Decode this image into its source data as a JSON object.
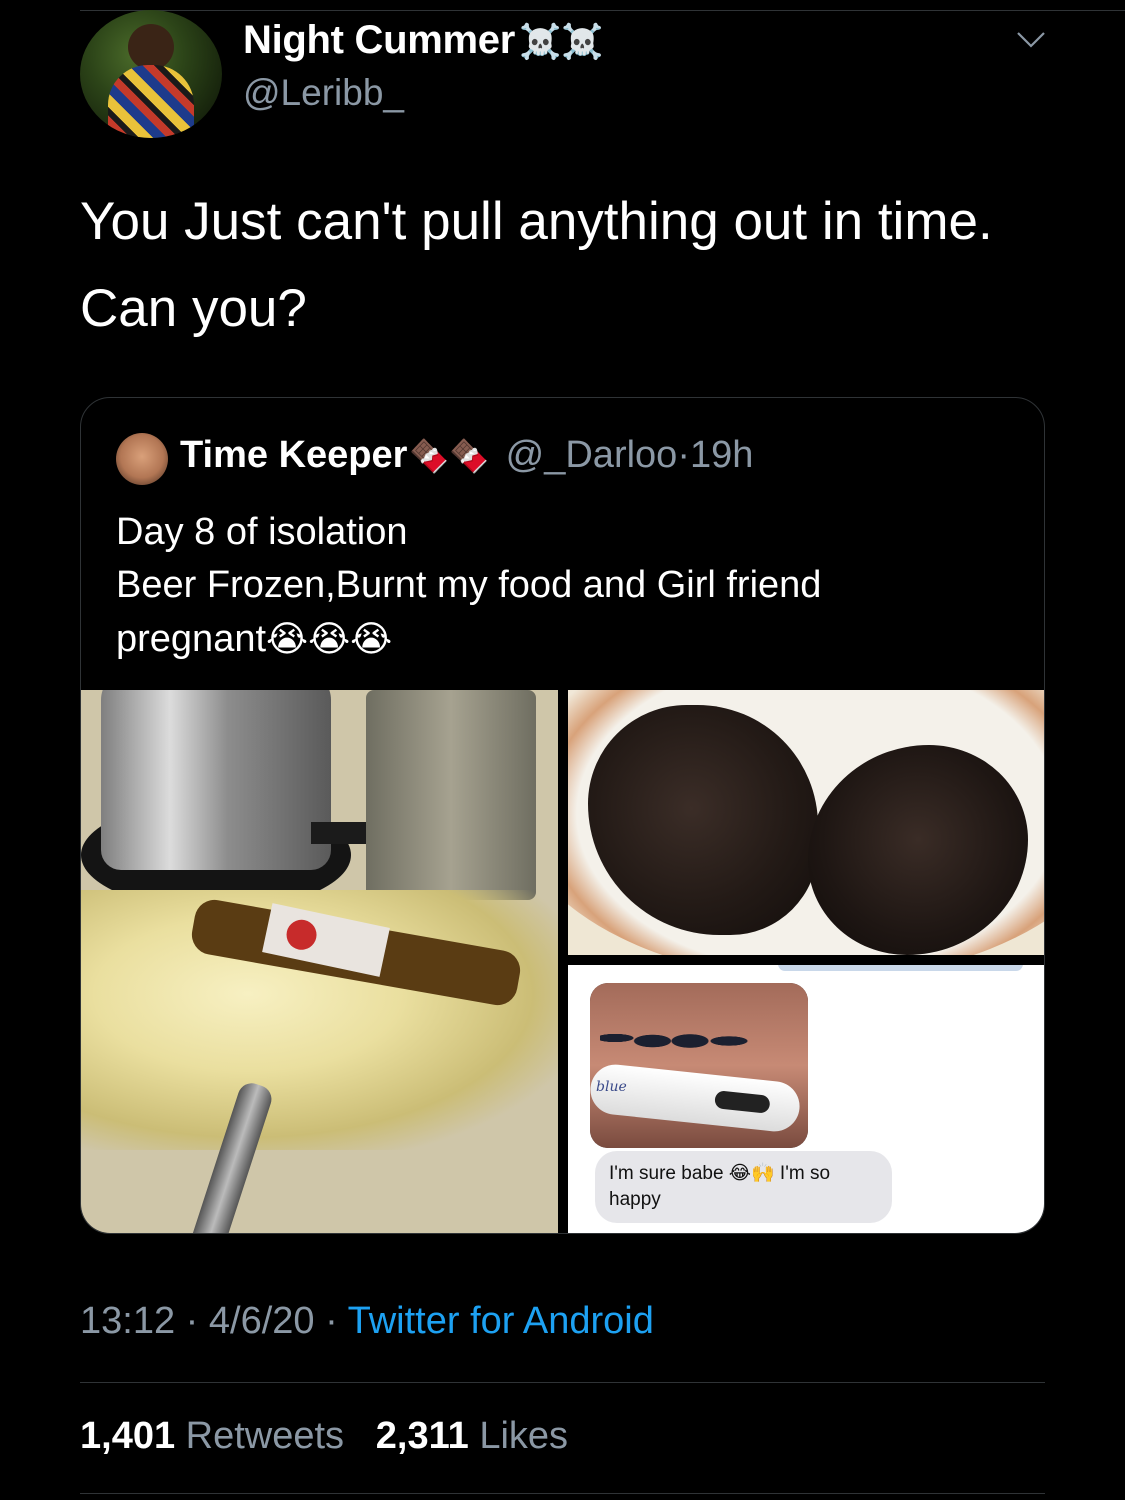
{
  "author": {
    "display_name": "Night Cummer",
    "name_emojis": "☠️☠️",
    "handle": "@Leribb_"
  },
  "tweet": {
    "text": "You Just can't pull anything out in time.\nCan you?"
  },
  "quoted_tweet": {
    "display_name": "Time Keeper",
    "name_emojis": "🍫🍫",
    "handle": "@_Darloo",
    "time_ago": "19h",
    "text_line1": "Day 8 of isolation",
    "text_line2": "Beer Frozen,Burnt my food and Girl friend",
    "text_line3": "pregnant",
    "text_emojis": "😭😭😭",
    "media": {
      "test_brand_fragment": "blue",
      "message_bubble": "I'm sure babe 😂🙌 I'm so happy"
    }
  },
  "meta": {
    "time": "13:12",
    "date": "4/6/20",
    "source": "Twitter for Android",
    "dot": "·"
  },
  "stats": {
    "retweets_count": "1,401",
    "retweets_label": "Retweets",
    "likes_count": "2,311",
    "likes_label": "Likes"
  },
  "icons": {
    "menu": "chevron-down-icon"
  },
  "colors": {
    "background": "#000000",
    "muted_text": "#8b98a5",
    "link": "#1da1f2",
    "border": "#2f3336"
  }
}
